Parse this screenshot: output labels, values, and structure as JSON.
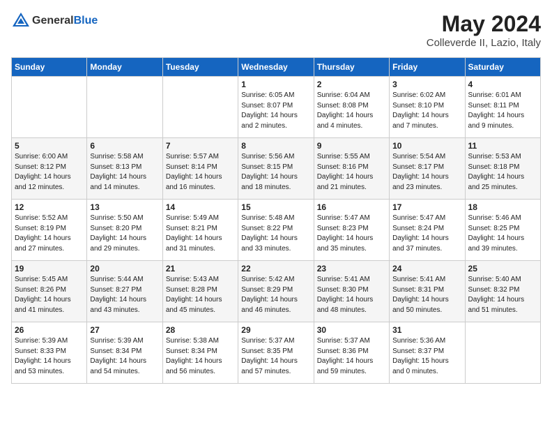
{
  "header": {
    "logo_general": "General",
    "logo_blue": "Blue",
    "month_title": "May 2024",
    "location": "Colleverde II, Lazio, Italy"
  },
  "weekdays": [
    "Sunday",
    "Monday",
    "Tuesday",
    "Wednesday",
    "Thursday",
    "Friday",
    "Saturday"
  ],
  "weeks": [
    [
      {
        "day": "",
        "sunrise": "",
        "sunset": "",
        "daylight": ""
      },
      {
        "day": "",
        "sunrise": "",
        "sunset": "",
        "daylight": ""
      },
      {
        "day": "",
        "sunrise": "",
        "sunset": "",
        "daylight": ""
      },
      {
        "day": "1",
        "sunrise": "Sunrise: 6:05 AM",
        "sunset": "Sunset: 8:07 PM",
        "daylight": "Daylight: 14 hours and 2 minutes."
      },
      {
        "day": "2",
        "sunrise": "Sunrise: 6:04 AM",
        "sunset": "Sunset: 8:08 PM",
        "daylight": "Daylight: 14 hours and 4 minutes."
      },
      {
        "day": "3",
        "sunrise": "Sunrise: 6:02 AM",
        "sunset": "Sunset: 8:10 PM",
        "daylight": "Daylight: 14 hours and 7 minutes."
      },
      {
        "day": "4",
        "sunrise": "Sunrise: 6:01 AM",
        "sunset": "Sunset: 8:11 PM",
        "daylight": "Daylight: 14 hours and 9 minutes."
      }
    ],
    [
      {
        "day": "5",
        "sunrise": "Sunrise: 6:00 AM",
        "sunset": "Sunset: 8:12 PM",
        "daylight": "Daylight: 14 hours and 12 minutes."
      },
      {
        "day": "6",
        "sunrise": "Sunrise: 5:58 AM",
        "sunset": "Sunset: 8:13 PM",
        "daylight": "Daylight: 14 hours and 14 minutes."
      },
      {
        "day": "7",
        "sunrise": "Sunrise: 5:57 AM",
        "sunset": "Sunset: 8:14 PM",
        "daylight": "Daylight: 14 hours and 16 minutes."
      },
      {
        "day": "8",
        "sunrise": "Sunrise: 5:56 AM",
        "sunset": "Sunset: 8:15 PM",
        "daylight": "Daylight: 14 hours and 18 minutes."
      },
      {
        "day": "9",
        "sunrise": "Sunrise: 5:55 AM",
        "sunset": "Sunset: 8:16 PM",
        "daylight": "Daylight: 14 hours and 21 minutes."
      },
      {
        "day": "10",
        "sunrise": "Sunrise: 5:54 AM",
        "sunset": "Sunset: 8:17 PM",
        "daylight": "Daylight: 14 hours and 23 minutes."
      },
      {
        "day": "11",
        "sunrise": "Sunrise: 5:53 AM",
        "sunset": "Sunset: 8:18 PM",
        "daylight": "Daylight: 14 hours and 25 minutes."
      }
    ],
    [
      {
        "day": "12",
        "sunrise": "Sunrise: 5:52 AM",
        "sunset": "Sunset: 8:19 PM",
        "daylight": "Daylight: 14 hours and 27 minutes."
      },
      {
        "day": "13",
        "sunrise": "Sunrise: 5:50 AM",
        "sunset": "Sunset: 8:20 PM",
        "daylight": "Daylight: 14 hours and 29 minutes."
      },
      {
        "day": "14",
        "sunrise": "Sunrise: 5:49 AM",
        "sunset": "Sunset: 8:21 PM",
        "daylight": "Daylight: 14 hours and 31 minutes."
      },
      {
        "day": "15",
        "sunrise": "Sunrise: 5:48 AM",
        "sunset": "Sunset: 8:22 PM",
        "daylight": "Daylight: 14 hours and 33 minutes."
      },
      {
        "day": "16",
        "sunrise": "Sunrise: 5:47 AM",
        "sunset": "Sunset: 8:23 PM",
        "daylight": "Daylight: 14 hours and 35 minutes."
      },
      {
        "day": "17",
        "sunrise": "Sunrise: 5:47 AM",
        "sunset": "Sunset: 8:24 PM",
        "daylight": "Daylight: 14 hours and 37 minutes."
      },
      {
        "day": "18",
        "sunrise": "Sunrise: 5:46 AM",
        "sunset": "Sunset: 8:25 PM",
        "daylight": "Daylight: 14 hours and 39 minutes."
      }
    ],
    [
      {
        "day": "19",
        "sunrise": "Sunrise: 5:45 AM",
        "sunset": "Sunset: 8:26 PM",
        "daylight": "Daylight: 14 hours and 41 minutes."
      },
      {
        "day": "20",
        "sunrise": "Sunrise: 5:44 AM",
        "sunset": "Sunset: 8:27 PM",
        "daylight": "Daylight: 14 hours and 43 minutes."
      },
      {
        "day": "21",
        "sunrise": "Sunrise: 5:43 AM",
        "sunset": "Sunset: 8:28 PM",
        "daylight": "Daylight: 14 hours and 45 minutes."
      },
      {
        "day": "22",
        "sunrise": "Sunrise: 5:42 AM",
        "sunset": "Sunset: 8:29 PM",
        "daylight": "Daylight: 14 hours and 46 minutes."
      },
      {
        "day": "23",
        "sunrise": "Sunrise: 5:41 AM",
        "sunset": "Sunset: 8:30 PM",
        "daylight": "Daylight: 14 hours and 48 minutes."
      },
      {
        "day": "24",
        "sunrise": "Sunrise: 5:41 AM",
        "sunset": "Sunset: 8:31 PM",
        "daylight": "Daylight: 14 hours and 50 minutes."
      },
      {
        "day": "25",
        "sunrise": "Sunrise: 5:40 AM",
        "sunset": "Sunset: 8:32 PM",
        "daylight": "Daylight: 14 hours and 51 minutes."
      }
    ],
    [
      {
        "day": "26",
        "sunrise": "Sunrise: 5:39 AM",
        "sunset": "Sunset: 8:33 PM",
        "daylight": "Daylight: 14 hours and 53 minutes."
      },
      {
        "day": "27",
        "sunrise": "Sunrise: 5:39 AM",
        "sunset": "Sunset: 8:34 PM",
        "daylight": "Daylight: 14 hours and 54 minutes."
      },
      {
        "day": "28",
        "sunrise": "Sunrise: 5:38 AM",
        "sunset": "Sunset: 8:34 PM",
        "daylight": "Daylight: 14 hours and 56 minutes."
      },
      {
        "day": "29",
        "sunrise": "Sunrise: 5:37 AM",
        "sunset": "Sunset: 8:35 PM",
        "daylight": "Daylight: 14 hours and 57 minutes."
      },
      {
        "day": "30",
        "sunrise": "Sunrise: 5:37 AM",
        "sunset": "Sunset: 8:36 PM",
        "daylight": "Daylight: 14 hours and 59 minutes."
      },
      {
        "day": "31",
        "sunrise": "Sunrise: 5:36 AM",
        "sunset": "Sunset: 8:37 PM",
        "daylight": "Daylight: 15 hours and 0 minutes."
      },
      {
        "day": "",
        "sunrise": "",
        "sunset": "",
        "daylight": ""
      }
    ]
  ]
}
